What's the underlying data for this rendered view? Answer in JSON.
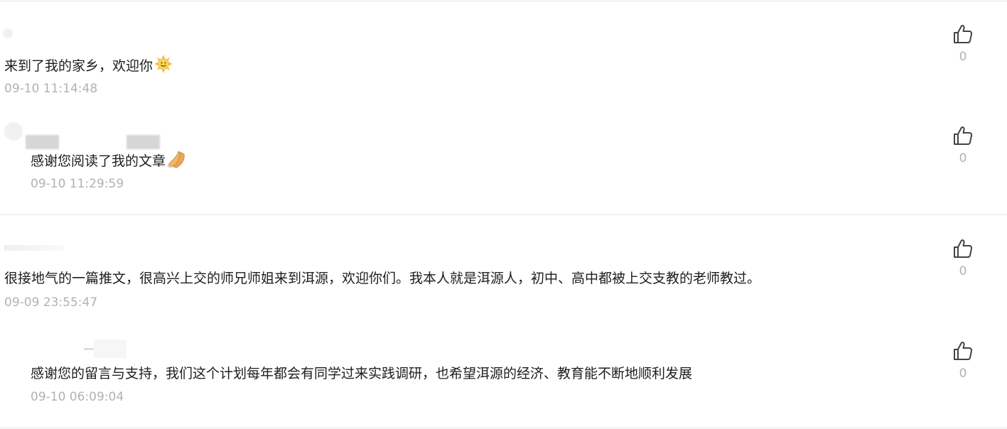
{
  "comments": [
    {
      "text": "来到了我的家乡，欢迎你",
      "emoji": "sun-face-icon",
      "time": "09-10 11:14:48",
      "likes": "0"
    },
    {
      "text": "感谢您阅读了我的文章",
      "emoji": "praying-hands-icon",
      "time": "09-10 11:29:59",
      "likes": "0"
    },
    {
      "text": "很接地气的一篇推文，很高兴上交的师兄师姐来到洱源，欢迎你们。我本人就是洱源人，初中、高中都被上交支教的老师教过。",
      "time": "09-09 23:55:47",
      "likes": "0"
    },
    {
      "text": "感谢您的留言与支持，我们这个计划每年都会有同学过来实践调研，也希望洱源的经济、教育能不断地顺利发展",
      "time": "09-10 06:09:04",
      "likes": "0"
    }
  ],
  "colors": {
    "text": "#1d1d1d",
    "meta": "#b2b2b2",
    "divider": "#e6e6e6",
    "icon": "#444444"
  }
}
